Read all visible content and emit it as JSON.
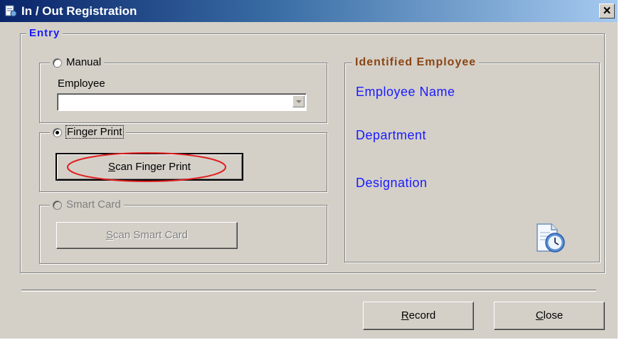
{
  "window": {
    "title": "In / Out Registration",
    "close_glyph": "×"
  },
  "entry": {
    "legend": "Entry",
    "manual": {
      "label": "Manual",
      "checked": false,
      "employee_label": "Employee",
      "employee_value": ""
    },
    "finger_print": {
      "label": "Finger Print",
      "checked": true,
      "button_label": "Scan Finger Print",
      "mnemonic": "S"
    },
    "smart_card": {
      "label": "Smart Card",
      "checked": false,
      "enabled": false,
      "button_label": "Scan Smart Card",
      "mnemonic": "S"
    }
  },
  "identified_employee": {
    "legend": "Identified Employee",
    "name_label": "Employee Name",
    "department_label": "Department",
    "designation_label": "Designation",
    "icon": "clock-document-icon"
  },
  "footer": {
    "record_label": "Record",
    "close_label": "Close"
  },
  "colors": {
    "title_start": "#0a246a",
    "entry_legend": "#1a1aff",
    "identified_legend": "#8b4513",
    "field_labels": "#1a1aff",
    "highlight_circle": "#e02020"
  }
}
